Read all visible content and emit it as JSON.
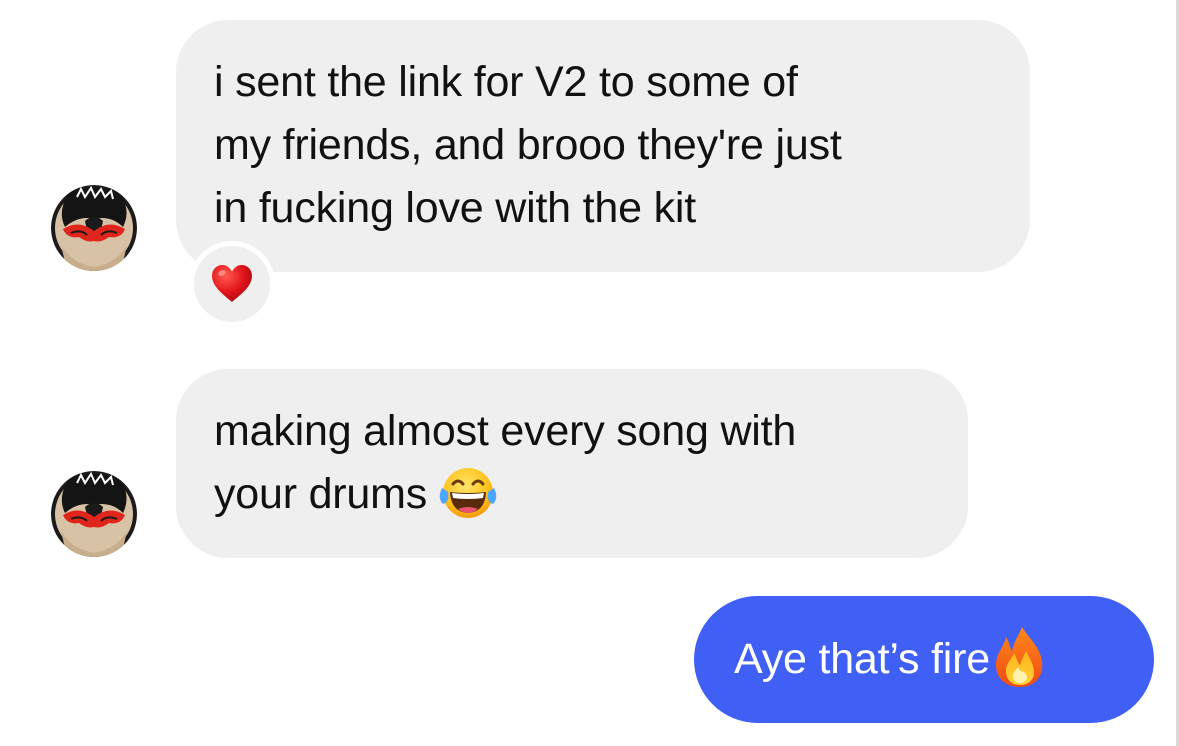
{
  "conversation": {
    "messages": [
      {
        "sender": "contact",
        "lines": [
          "i sent the link for V2 to some of",
          "my friends, and brooo they're just",
          "in fucking love with the kit"
        ],
        "reaction_icon": "heart-emoji"
      },
      {
        "sender": "contact",
        "lines": [
          "making almost every song with",
          "your drums"
        ],
        "trailing_icon": "tears-of-joy-emoji"
      },
      {
        "sender": "me",
        "text": "Aye that’s fire",
        "trailing_icon": "fire-emoji"
      }
    ]
  },
  "colors": {
    "incoming_bubble": "#efefef",
    "outgoing_bubble": "#3f5ff5",
    "incoming_text": "#111111",
    "outgoing_text": "#ffffff"
  }
}
